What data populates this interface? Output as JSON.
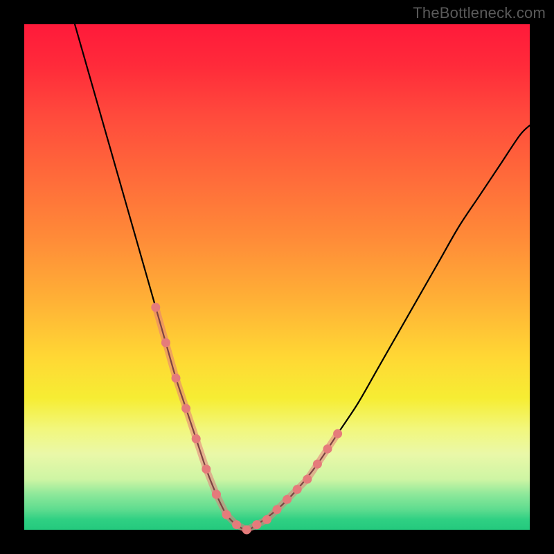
{
  "watermark": {
    "text": "TheBottleneck.com"
  },
  "chart_data": {
    "type": "line",
    "title": "",
    "xlabel": "",
    "ylabel": "",
    "xlim": [
      0,
      100
    ],
    "ylim": [
      0,
      100
    ],
    "grid": false,
    "legend": false,
    "background_gradient": {
      "top_color": "#ff1a3a",
      "bottom_color": "#24c97d",
      "description": "vertical red-to-green gradient"
    },
    "series": [
      {
        "name": "main-curve",
        "color": "#000000",
        "stroke_width": 2,
        "style": "solid",
        "x": [
          10,
          12,
          14,
          16,
          18,
          20,
          22,
          24,
          26,
          28,
          30,
          32,
          34,
          36,
          38,
          40,
          42,
          44,
          46,
          50,
          54,
          58,
          62,
          66,
          70,
          74,
          78,
          82,
          86,
          90,
          94,
          98,
          100
        ],
        "values": [
          100,
          93,
          86,
          79,
          72,
          65,
          58,
          51,
          44,
          37,
          30,
          24,
          18,
          12,
          7,
          3,
          1,
          0,
          1,
          4,
          8,
          13,
          19,
          25,
          32,
          39,
          46,
          53,
          60,
          66,
          72,
          78,
          80
        ]
      },
      {
        "name": "marker-dots",
        "color": "#e57b7b",
        "stroke_width": 5,
        "style": "dotted-segments",
        "segments": [
          {
            "x": [
              26,
              28,
              30,
              32,
              34,
              36,
              38
            ],
            "values": [
              44,
              37,
              30,
              24,
              18,
              12,
              7
            ]
          },
          {
            "x": [
              38,
              40,
              42,
              44,
              46
            ],
            "values": [
              7,
              3,
              1,
              0,
              1
            ]
          },
          {
            "x": [
              46,
              48,
              50,
              52,
              54,
              56,
              58,
              60,
              62
            ],
            "values": [
              1,
              2,
              4,
              6,
              8,
              10,
              13,
              16,
              19
            ]
          }
        ]
      }
    ]
  }
}
